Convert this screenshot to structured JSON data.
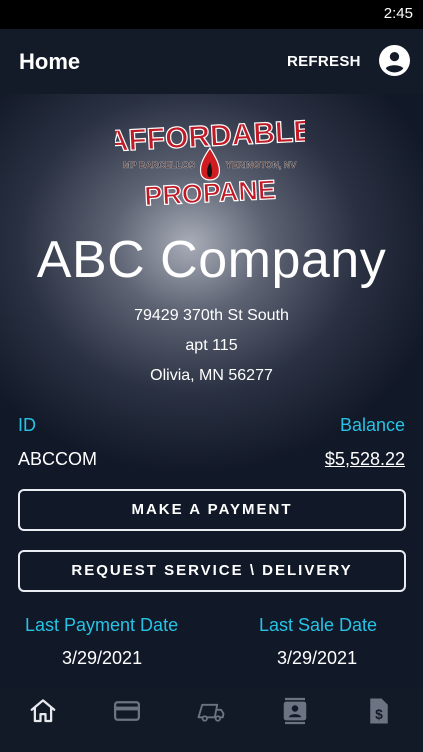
{
  "status_bar": {
    "time": "2:45"
  },
  "app_bar": {
    "title": "Home",
    "refresh_label": "REFRESH"
  },
  "logo": {
    "top_text": "AFFORDABLE",
    "bottom_text": "PROPANE",
    "left_text": "MP BARCELLOS",
    "right_text": "YERINGTON, NV"
  },
  "customer": {
    "name": "ABC Company",
    "address_line1": "79429 370th St South",
    "address_line2": "apt 115",
    "address_line3": "Olivia, MN 56277"
  },
  "account": {
    "id_label": "ID",
    "id_value": "ABCCOM",
    "balance_label": "Balance",
    "balance_value": "$5,528.22"
  },
  "actions": {
    "payment_label": "MAKE A PAYMENT",
    "service_label": "REQUEST SERVICE \\ DELIVERY"
  },
  "dates": {
    "last_payment_label": "Last Payment Date",
    "last_payment_value": "3/29/2021",
    "last_sale_label": "Last Sale Date",
    "last_sale_value": "3/29/2021"
  },
  "nav": {
    "items": [
      "home-icon",
      "credit-card-icon",
      "truck-icon",
      "contacts-icon",
      "invoice-icon"
    ],
    "active": "home-icon"
  },
  "colors": {
    "accent": "#27c3e6",
    "logo_red": "#c01a26",
    "background": "#111827"
  }
}
